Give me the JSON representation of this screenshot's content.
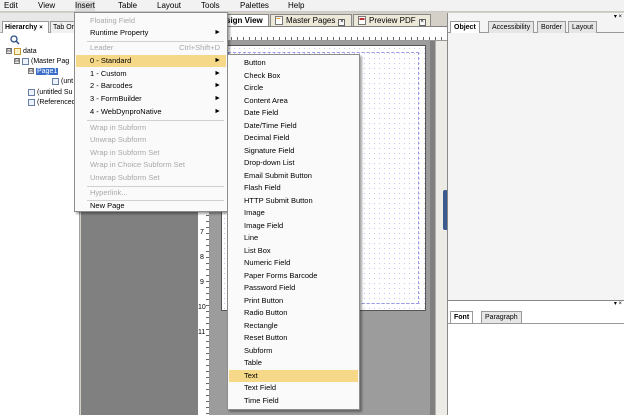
{
  "menubar": {
    "items": [
      "Edit",
      "View",
      "Insert",
      "Table",
      "Layout",
      "Tools",
      "Palettes",
      "Help"
    ]
  },
  "left_panel": {
    "tabs": [
      {
        "label": "Hierarchy",
        "close": "×"
      },
      {
        "label": "Tab Or",
        "close": ""
      }
    ],
    "search_icon": "magnifier-icon",
    "tree": [
      {
        "label": "data",
        "toggle": "⊟"
      },
      {
        "label": "(Master Pag",
        "toggle": "⊟"
      },
      {
        "label": "Page1",
        "toggle": "⊟"
      },
      {
        "label": "(unt",
        "toggle": ""
      },
      {
        "label": "(untitled Su",
        "toggle": ""
      },
      {
        "label": "(Referenced",
        "toggle": ""
      }
    ]
  },
  "center": {
    "tabs": [
      {
        "label": "sign View",
        "close": "×"
      },
      {
        "label": "Master Pages",
        "close": "×"
      },
      {
        "label": "Preview PDF",
        "close": "×"
      }
    ],
    "ruler_numbers": [
      "7",
      "8",
      "9",
      "10",
      "11"
    ]
  },
  "right_panel": {
    "upper_tabs": [
      "Object",
      "Accessibility",
      "Border",
      "Layout"
    ],
    "lower_tabs": [
      "Font",
      "Paragraph"
    ],
    "controls": "▾ ×"
  },
  "insert_menu": {
    "items": [
      {
        "label": "Floating Field",
        "disabled": true
      },
      {
        "label": "Runtime Property",
        "submenu": true
      },
      {
        "label": "Leader",
        "shortcut": "Ctrl+Shift+D",
        "disabled": true
      },
      {
        "label": "0 - Standard",
        "submenu": true,
        "hover": true
      },
      {
        "label": "1 - Custom",
        "submenu": true
      },
      {
        "label": "2 - Barcodes",
        "submenu": true
      },
      {
        "label": "3 - FormBuilder",
        "submenu": true
      },
      {
        "label": "4 - WebDynproNative",
        "submenu": true
      },
      {
        "label": "Wrap in Subform",
        "disabled": true
      },
      {
        "label": "Unwrap Subform",
        "disabled": true
      },
      {
        "label": "Wrap in Subform Set",
        "disabled": true
      },
      {
        "label": "Wrap in Choice Subform Set",
        "disabled": true
      },
      {
        "label": "Unwrap Subform Set",
        "disabled": true
      },
      {
        "label": "Hyperlink...",
        "disabled": true
      },
      {
        "label": "New Page"
      }
    ]
  },
  "standard_submenu": {
    "items": [
      "Button",
      "Check Box",
      "Circle",
      "Content Area",
      "Date Field",
      "Date/Time Field",
      "Decimal Field",
      "Signature Field",
      "Drop-down List",
      "Email Submit Button",
      "Flash Field",
      "HTTP Submit Button",
      "Image",
      "Image Field",
      "Line",
      "List Box",
      "Numeric Field",
      "Paper Forms Barcode",
      "Password Field",
      "Print Button",
      "Radio Button",
      "Rectangle",
      "Reset Button",
      "Subform",
      "Table",
      "Text",
      "Text Field",
      "Time Field"
    ],
    "highlighted": "Text"
  }
}
